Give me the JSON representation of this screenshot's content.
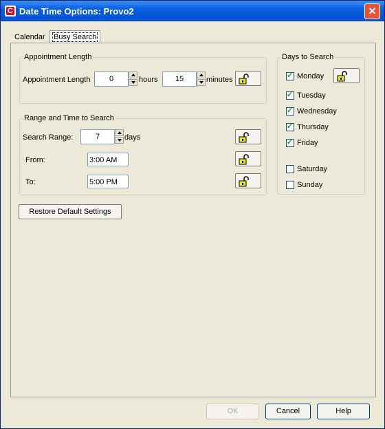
{
  "window": {
    "title": "Date Time Options:  Provo2",
    "icon_letter": "C",
    "close_symbol": "✕"
  },
  "tabs": [
    {
      "label": "Calendar",
      "selected": false
    },
    {
      "label": "Busy Search",
      "selected": true
    }
  ],
  "appointment_length": {
    "group_label": "Appointment Length",
    "row_label": "Appointment Length",
    "hours_value": "0",
    "hours_unit": "hours",
    "minutes_value": "15",
    "minutes_unit": "minutes"
  },
  "range_time": {
    "group_label": "Range and Time to Search",
    "search_range_label": "Search Range:",
    "search_range_value": "7",
    "search_range_unit": "days",
    "from_label": "From:",
    "from_value": "3:00 AM",
    "to_label": "To:",
    "to_value": "5:00 PM"
  },
  "days": {
    "group_label": "Days to Search",
    "items": [
      {
        "label": "Monday",
        "checked": true
      },
      {
        "label": "Tuesday",
        "checked": true
      },
      {
        "label": "Wednesday",
        "checked": true
      },
      {
        "label": "Thursday",
        "checked": true
      },
      {
        "label": "Friday",
        "checked": true
      },
      {
        "label": "Saturday",
        "checked": false
      },
      {
        "label": "Sunday",
        "checked": false
      }
    ]
  },
  "buttons": {
    "restore": "Restore Default Settings",
    "ok": "OK",
    "cancel": "Cancel",
    "help": "Help"
  },
  "colors": {
    "title_bar": "#0a5fe0",
    "dialog_bg": "#ece9d8",
    "close_button": "#e2553c",
    "lock_icon": "#e8e040"
  }
}
